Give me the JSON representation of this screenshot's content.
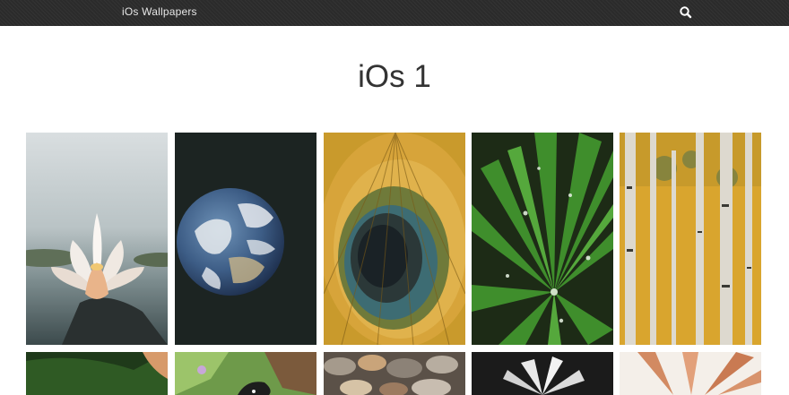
{
  "navbar": {
    "brand_label": "iOs Wallpapers",
    "search_icon": "search-icon",
    "background": "#2b2b2b"
  },
  "page": {
    "title": "iOs 1"
  },
  "gallery": {
    "rows": [
      [
        {
          "name": "water-lily",
          "icon": "lotus-flower-image"
        },
        {
          "name": "earth",
          "icon": "earth-globe-image"
        },
        {
          "name": "peacock-feather",
          "icon": "peacock-feather-image"
        },
        {
          "name": "green-leaf-drops",
          "icon": "leaf-waterdrops-image"
        },
        {
          "name": "aspen-trees",
          "icon": "birch-forest-image"
        }
      ],
      [
        {
          "name": "dark-green-leaf",
          "icon": "leaf-image"
        },
        {
          "name": "butterfly-garden",
          "icon": "butterfly-image"
        },
        {
          "name": "pebbles",
          "icon": "pebbles-image"
        },
        {
          "name": "white-flower",
          "icon": "white-flower-image"
        },
        {
          "name": "pink-lily",
          "icon": "lily-petals-image"
        }
      ]
    ]
  }
}
